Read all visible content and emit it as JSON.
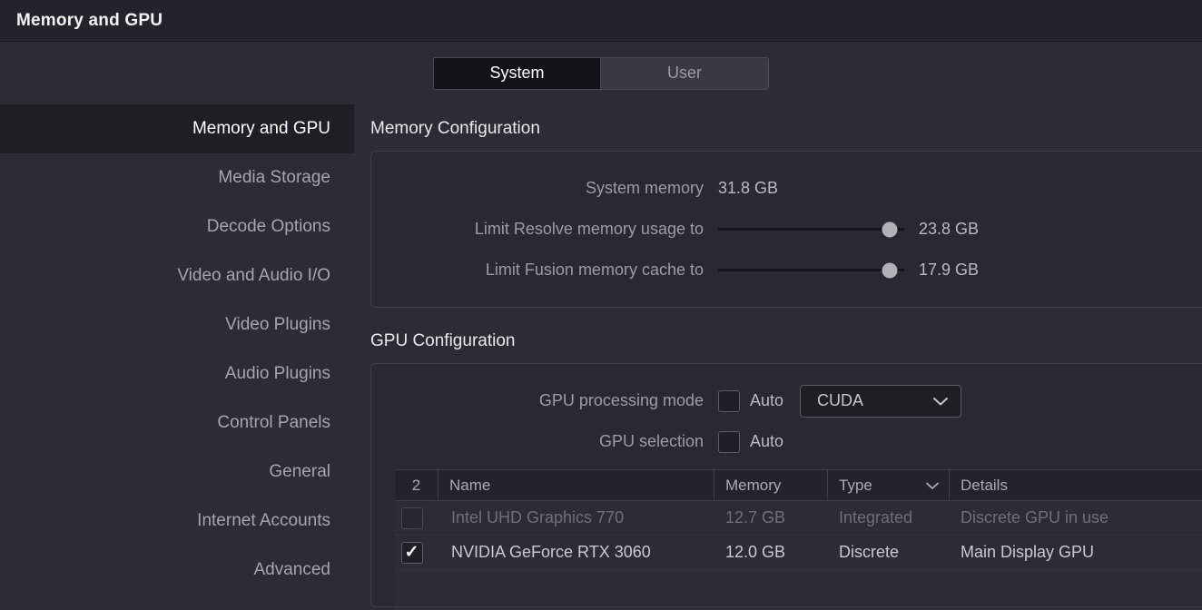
{
  "window": {
    "title": "Memory and GPU"
  },
  "tabs": [
    {
      "label": "System",
      "active": true
    },
    {
      "label": "User",
      "active": false
    }
  ],
  "sidebar": {
    "items": [
      {
        "label": "Memory and GPU",
        "active": true
      },
      {
        "label": "Media Storage",
        "active": false
      },
      {
        "label": "Decode Options",
        "active": false
      },
      {
        "label": "Video and Audio I/O",
        "active": false
      },
      {
        "label": "Video Plugins",
        "active": false
      },
      {
        "label": "Audio Plugins",
        "active": false
      },
      {
        "label": "Control Panels",
        "active": false
      },
      {
        "label": "General",
        "active": false
      },
      {
        "label": "Internet Accounts",
        "active": false
      },
      {
        "label": "Advanced",
        "active": false
      }
    ]
  },
  "memory_configuration": {
    "section_title": "Memory Configuration",
    "system_memory": {
      "label": "System memory",
      "value": "31.8 GB"
    },
    "resolve_limit": {
      "label": "Limit Resolve memory usage to",
      "value": "23.8 GB",
      "slider_percent": 92
    },
    "fusion_limit": {
      "label": "Limit Fusion memory cache to",
      "value": "17.9 GB",
      "slider_percent": 92
    }
  },
  "gpu_configuration": {
    "section_title": "GPU Configuration",
    "processing_mode": {
      "label": "GPU processing mode",
      "auto_label": "Auto",
      "auto_checked": false,
      "selected_mode": "CUDA"
    },
    "gpu_selection": {
      "label": "GPU selection",
      "auto_label": "Auto",
      "auto_checked": false
    },
    "table": {
      "headers": {
        "count": "2",
        "name": "Name",
        "memory": "Memory",
        "type": "Type",
        "details": "Details"
      },
      "rows": [
        {
          "checked": false,
          "enabled": false,
          "name": "Intel UHD Graphics 770",
          "memory": "12.7 GB",
          "type": "Integrated",
          "details": "Discrete GPU in use"
        },
        {
          "checked": true,
          "enabled": true,
          "name": "NVIDIA GeForce RTX 3060",
          "memory": "12.0 GB",
          "type": "Discrete",
          "details": "Main Display GPU"
        }
      ]
    }
  },
  "colors": {
    "background": "#2b2d35",
    "titlebar": "#22242b",
    "panel": "#282a31",
    "panel_border": "#3d3f48",
    "active_item": "#1e1f25",
    "text_primary": "#e9e9ec",
    "text_secondary": "#9b9da5",
    "text_disabled": "#6e7077",
    "slider_handle": "#b0b2b8"
  }
}
